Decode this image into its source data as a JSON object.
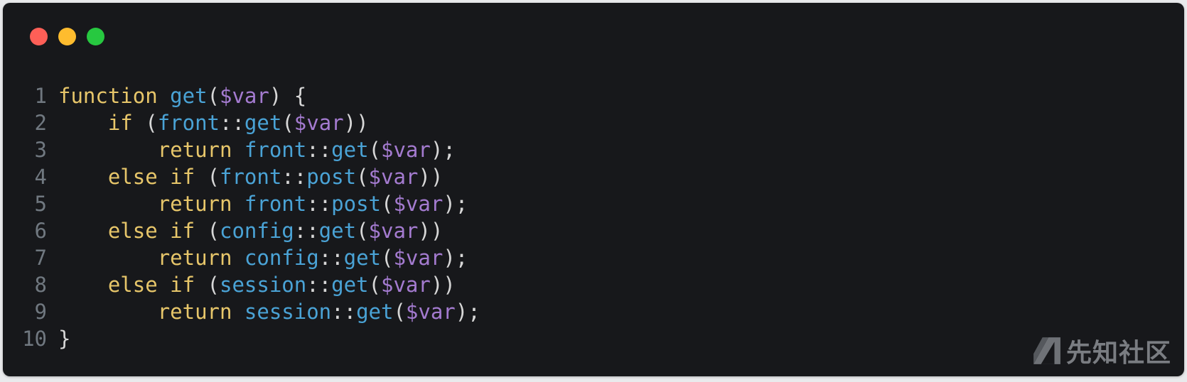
{
  "window": {
    "controls": [
      {
        "name": "close-dot",
        "color": "#fe5f57"
      },
      {
        "name": "minimize-dot",
        "color": "#febc2e"
      },
      {
        "name": "zoom-dot",
        "color": "#27c840"
      }
    ]
  },
  "colors": {
    "keyword": "#e7c66a",
    "function": "#4aa3d6",
    "variable": "#a47bd0",
    "text": "#d7d7d7",
    "line_number": "#707880"
  },
  "code": {
    "lines": [
      {
        "n": "1",
        "tokens": [
          {
            "t": "function",
            "c": "keyword"
          },
          {
            "t": " ",
            "c": "text"
          },
          {
            "t": "get",
            "c": "function"
          },
          {
            "t": "(",
            "c": "text"
          },
          {
            "t": "$var",
            "c": "variable"
          },
          {
            "t": ") {",
            "c": "text"
          }
        ]
      },
      {
        "n": "2",
        "tokens": [
          {
            "t": "    ",
            "c": "text"
          },
          {
            "t": "if",
            "c": "keyword"
          },
          {
            "t": " (",
            "c": "text"
          },
          {
            "t": "front",
            "c": "function"
          },
          {
            "t": "::",
            "c": "text"
          },
          {
            "t": "get",
            "c": "function"
          },
          {
            "t": "(",
            "c": "text"
          },
          {
            "t": "$var",
            "c": "variable"
          },
          {
            "t": "))",
            "c": "text"
          }
        ]
      },
      {
        "n": "3",
        "tokens": [
          {
            "t": "        ",
            "c": "text"
          },
          {
            "t": "return",
            "c": "keyword"
          },
          {
            "t": " ",
            "c": "text"
          },
          {
            "t": "front",
            "c": "function"
          },
          {
            "t": "::",
            "c": "text"
          },
          {
            "t": "get",
            "c": "function"
          },
          {
            "t": "(",
            "c": "text"
          },
          {
            "t": "$var",
            "c": "variable"
          },
          {
            "t": ");",
            "c": "text"
          }
        ]
      },
      {
        "n": "4",
        "tokens": [
          {
            "t": "    ",
            "c": "text"
          },
          {
            "t": "else if",
            "c": "keyword"
          },
          {
            "t": " (",
            "c": "text"
          },
          {
            "t": "front",
            "c": "function"
          },
          {
            "t": "::",
            "c": "text"
          },
          {
            "t": "post",
            "c": "function"
          },
          {
            "t": "(",
            "c": "text"
          },
          {
            "t": "$var",
            "c": "variable"
          },
          {
            "t": "))",
            "c": "text"
          }
        ]
      },
      {
        "n": "5",
        "tokens": [
          {
            "t": "        ",
            "c": "text"
          },
          {
            "t": "return",
            "c": "keyword"
          },
          {
            "t": " ",
            "c": "text"
          },
          {
            "t": "front",
            "c": "function"
          },
          {
            "t": "::",
            "c": "text"
          },
          {
            "t": "post",
            "c": "function"
          },
          {
            "t": "(",
            "c": "text"
          },
          {
            "t": "$var",
            "c": "variable"
          },
          {
            "t": ");",
            "c": "text"
          }
        ]
      },
      {
        "n": "6",
        "tokens": [
          {
            "t": "    ",
            "c": "text"
          },
          {
            "t": "else if",
            "c": "keyword"
          },
          {
            "t": " (",
            "c": "text"
          },
          {
            "t": "config",
            "c": "function"
          },
          {
            "t": "::",
            "c": "text"
          },
          {
            "t": "get",
            "c": "function"
          },
          {
            "t": "(",
            "c": "text"
          },
          {
            "t": "$var",
            "c": "variable"
          },
          {
            "t": "))",
            "c": "text"
          }
        ]
      },
      {
        "n": "7",
        "tokens": [
          {
            "t": "        ",
            "c": "text"
          },
          {
            "t": "return",
            "c": "keyword"
          },
          {
            "t": " ",
            "c": "text"
          },
          {
            "t": "config",
            "c": "function"
          },
          {
            "t": "::",
            "c": "text"
          },
          {
            "t": "get",
            "c": "function"
          },
          {
            "t": "(",
            "c": "text"
          },
          {
            "t": "$var",
            "c": "variable"
          },
          {
            "t": ");",
            "c": "text"
          }
        ]
      },
      {
        "n": "8",
        "tokens": [
          {
            "t": "    ",
            "c": "text"
          },
          {
            "t": "else if",
            "c": "keyword"
          },
          {
            "t": " (",
            "c": "text"
          },
          {
            "t": "session",
            "c": "function"
          },
          {
            "t": "::",
            "c": "text"
          },
          {
            "t": "get",
            "c": "function"
          },
          {
            "t": "(",
            "c": "text"
          },
          {
            "t": "$var",
            "c": "variable"
          },
          {
            "t": "))",
            "c": "text"
          }
        ]
      },
      {
        "n": "9",
        "tokens": [
          {
            "t": "        ",
            "c": "text"
          },
          {
            "t": "return",
            "c": "keyword"
          },
          {
            "t": " ",
            "c": "text"
          },
          {
            "t": "session",
            "c": "function"
          },
          {
            "t": "::",
            "c": "text"
          },
          {
            "t": "get",
            "c": "function"
          },
          {
            "t": "(",
            "c": "text"
          },
          {
            "t": "$var",
            "c": "variable"
          },
          {
            "t": ");",
            "c": "text"
          }
        ]
      },
      {
        "n": "10",
        "tokens": [
          {
            "t": "}",
            "c": "text"
          }
        ]
      }
    ]
  },
  "watermark": {
    "text": "先知社区",
    "icon": "xianzhi-logo-icon"
  }
}
